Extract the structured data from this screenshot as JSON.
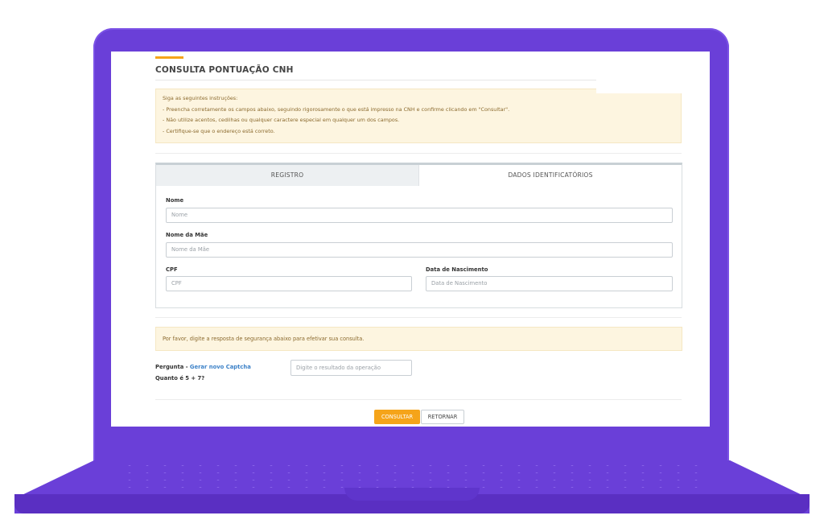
{
  "page": {
    "title": "CONSULTA PONTUAÇÃO CNH"
  },
  "instructions": {
    "heading": "Siga as seguintes instruções:",
    "items": [
      "- Preencha corretamente os campos abaixo, seguindo rigorosamente o que está impresso na CNH e confirme clicando em \"Consultar\".",
      "- Não utilize acentos, cedilhas ou qualquer caractere especial em qualquer um dos campos.",
      "- Certifique-se que o endereço está correto."
    ]
  },
  "tabs": [
    {
      "label": "REGISTRO",
      "active": false
    },
    {
      "label": "DADOS IDENTIFICATÓRIOS",
      "active": true
    }
  ],
  "form": {
    "nome": {
      "label": "Nome",
      "placeholder": "Nome",
      "value": ""
    },
    "nome_mae": {
      "label": "Nome da Mãe",
      "placeholder": "Nome da Mãe",
      "value": ""
    },
    "cpf": {
      "label": "CPF",
      "placeholder": "CPF",
      "value": ""
    },
    "data_nascimento": {
      "label": "Data de Nascimento",
      "placeholder": "Data de Nascimento",
      "value": ""
    }
  },
  "captcha": {
    "note": "Por favor, digite a resposta de segurança abaixo para efetivar sua consulta.",
    "question_label": "Pergunta",
    "separator": " - ",
    "regenerate_link": "Gerar novo Captcha",
    "question": "Quanto é 5 + 7?",
    "answer_placeholder": "Digite o resultado da operação"
  },
  "buttons": {
    "submit": "CONSULTAR",
    "back": "RETORNAR"
  },
  "colors": {
    "accent": "#f5a41a",
    "laptop": "#6a3fd8",
    "alert_bg": "#fdf5e0",
    "link": "#3d82c8"
  }
}
